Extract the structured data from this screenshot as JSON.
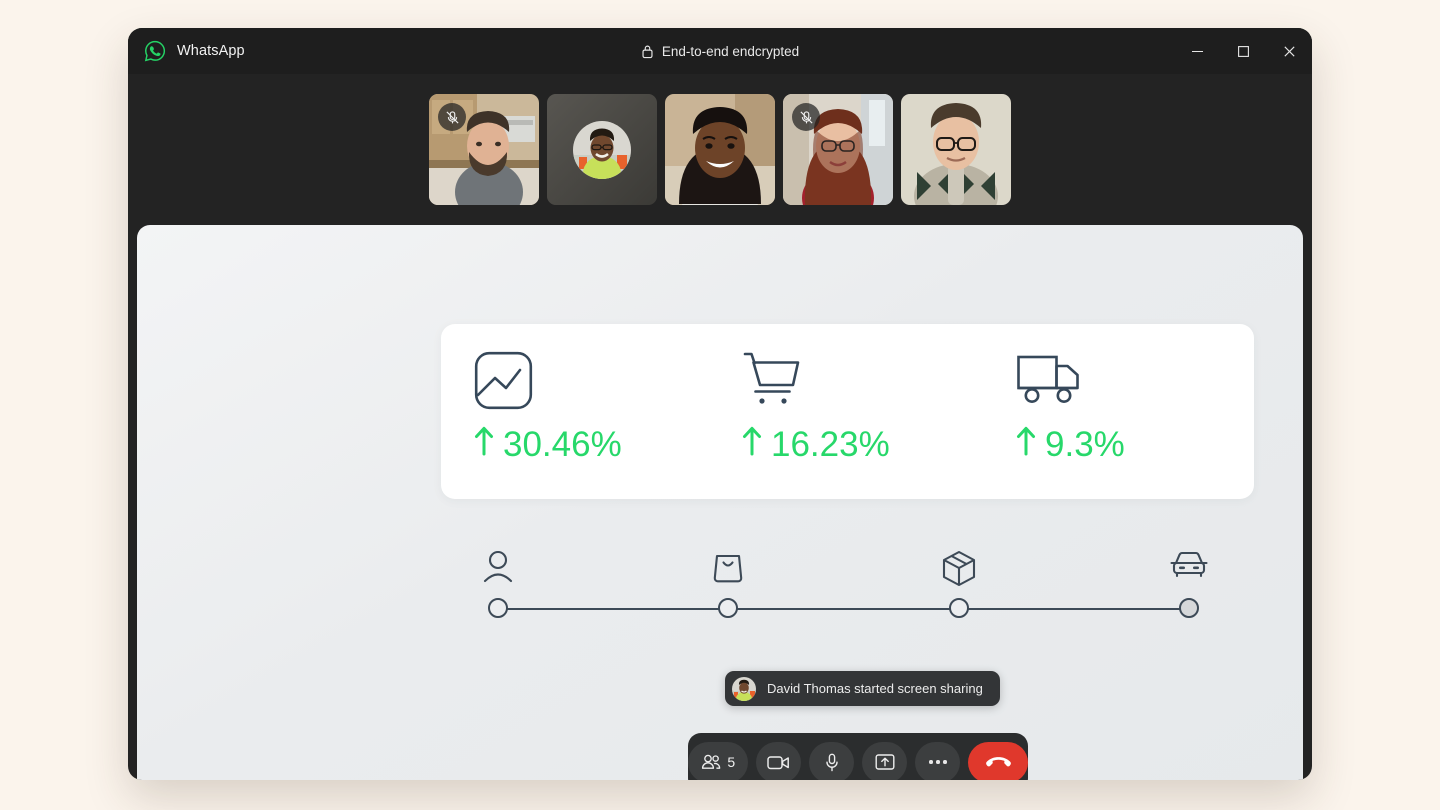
{
  "window": {
    "brand_name": "WhatsApp",
    "encryption_label": "End-to-end endcrypted",
    "lock_icon": "lock-icon",
    "logo_icon": "whatsapp-logo-icon",
    "controls": [
      {
        "name": "minimize-button",
        "icon": "minimize-icon"
      },
      {
        "name": "maximize-button",
        "icon": "maximize-icon"
      },
      {
        "name": "close-button",
        "icon": "close-icon"
      }
    ]
  },
  "participants": [
    {
      "name": "participant-tile-1",
      "muted": true,
      "mic_icon": "mic-off-icon",
      "video_on": true
    },
    {
      "name": "participant-tile-2",
      "muted": false,
      "mic_icon": "",
      "video_on": false
    },
    {
      "name": "participant-tile-3",
      "muted": false,
      "mic_icon": "",
      "video_on": true
    },
    {
      "name": "participant-tile-4",
      "muted": true,
      "mic_icon": "mic-off-icon",
      "video_on": true
    },
    {
      "name": "participant-tile-5",
      "muted": false,
      "mic_icon": "",
      "video_on": true
    }
  ],
  "shared_screen": {
    "stats": [
      {
        "icon": "image-chart-icon",
        "trend": "up",
        "arrow": "↑",
        "value": "30.46%"
      },
      {
        "icon": "shopping-cart-icon",
        "trend": "up",
        "arrow": "↑",
        "value": "16.23%"
      },
      {
        "icon": "delivery-truck-icon",
        "trend": "up",
        "arrow": "↑",
        "value": "9.3%"
      }
    ],
    "stat_color": "#27d86a",
    "stepper": {
      "steps": [
        {
          "icon": "person-icon",
          "state": "open"
        },
        {
          "icon": "shopping-bag-icon",
          "state": "open"
        },
        {
          "icon": "package-box-icon",
          "state": "open"
        },
        {
          "icon": "car-icon",
          "state": "filled"
        }
      ]
    }
  },
  "toast": {
    "avatar": "participant-avatar",
    "message": "David Thomas started screen sharing"
  },
  "controls": {
    "participants_count": "5",
    "buttons": [
      {
        "name": "participants-button",
        "icon": "people-icon"
      },
      {
        "name": "camera-button",
        "icon": "video-camera-icon"
      },
      {
        "name": "microphone-button",
        "icon": "microphone-icon"
      },
      {
        "name": "share-screen-button",
        "icon": "screen-share-icon"
      },
      {
        "name": "more-options-button",
        "icon": "ellipsis-icon"
      },
      {
        "name": "end-call-button",
        "icon": "hangup-phone-icon"
      }
    ],
    "end_call_color": "#e0382c"
  }
}
